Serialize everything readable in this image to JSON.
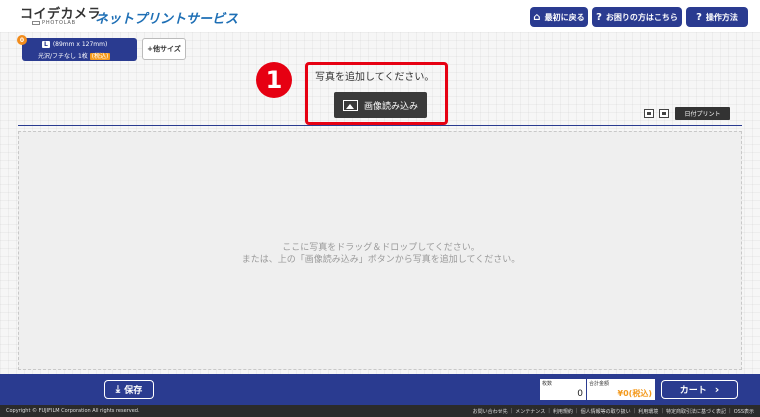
{
  "header": {
    "logo": "コイデカメラ",
    "logo_sub": "PHOTOLAB",
    "service_title": "ネットプリントサービス",
    "buttons": {
      "home": "最初に戻る",
      "help": "お困りの方はこちら",
      "howto": "操作方法"
    }
  },
  "size_tab": {
    "badge_count": "0",
    "l_label": "L",
    "dimensions": "(89mm x 127mm)",
    "finish": "光沢/フチなし",
    "qty_prefix": "1枚",
    "qty_suffix": "(税込)",
    "add_size_label": "+他サイズ"
  },
  "callout": {
    "number": "1",
    "prompt": "写真を追加してください。",
    "load_button": "画像読み込み"
  },
  "toolbar": {
    "date_print": "日付プリント"
  },
  "drop_zone": {
    "line1": "ここに写真をドラッグ＆ドロップしてください。",
    "line2": "または、上の「画像読み込み」ボタンから写真を追加してください。"
  },
  "footer": {
    "save": "保存",
    "count_label": "枚数",
    "count_value": "0",
    "total_label": "合計金額",
    "total_value": "¥0(税込)",
    "cart": "カート"
  },
  "bottom": {
    "copyright": "Copyright © FUJIFILM Corporation All rights reserved.",
    "links": [
      "お問い合わせ先",
      "メンテナンス",
      "利用規約",
      "個人情報等の取り扱い",
      "利用環境",
      "特定商取引法に基づく表記",
      "OSS表示"
    ]
  },
  "colors": {
    "primary": "#2a3b90",
    "accent_red": "#e60012",
    "orange": "#f39a1e"
  }
}
